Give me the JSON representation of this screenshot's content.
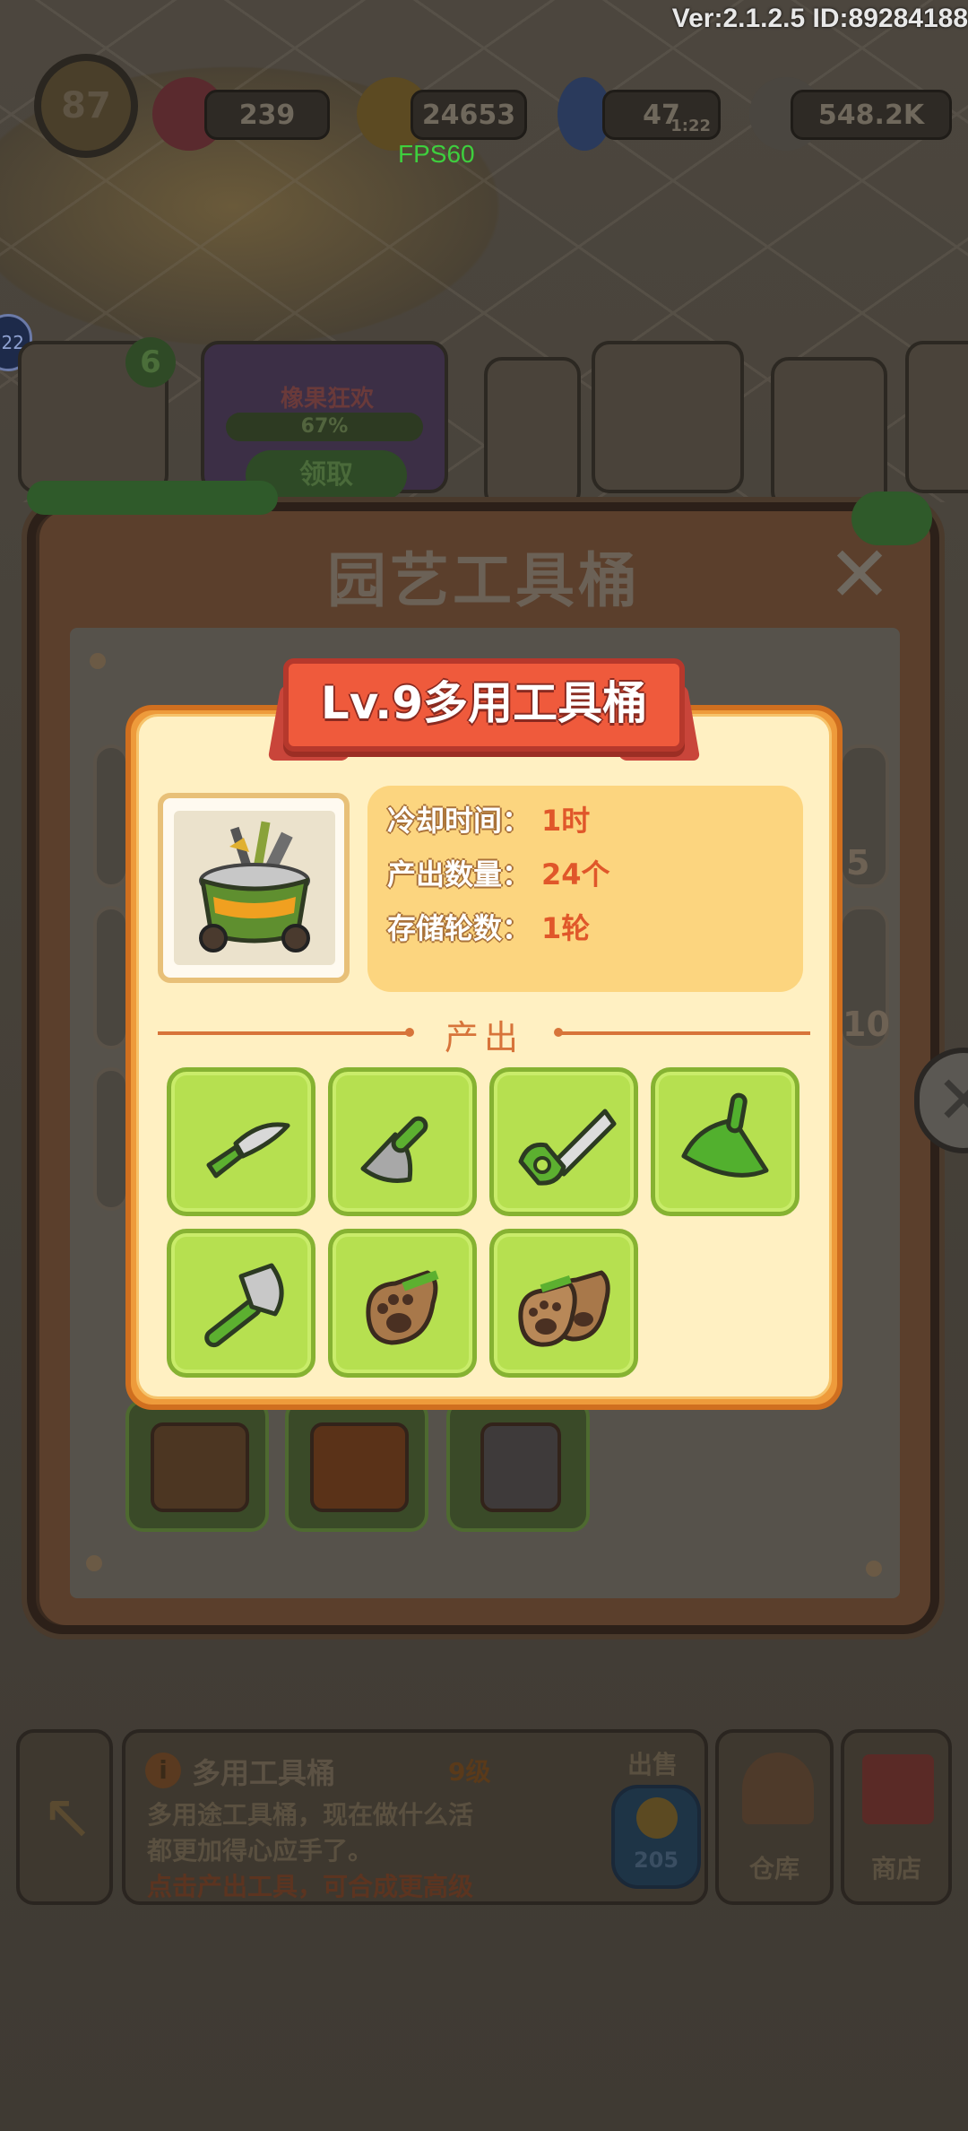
{
  "status": {
    "version_text": "Ver:2.1.2.5 ID:89284188",
    "fps_text": "FPS60"
  },
  "hud": {
    "level": "87",
    "gems": "239",
    "coins": "24653",
    "energy": "47",
    "energy_timer": "1:22",
    "seeds": "548.2K"
  },
  "background": {
    "badge_count": "6",
    "event_title": "橡果狂欢",
    "event_progress": "67%",
    "event_button": "领取",
    "left_edge_badge": "22",
    "side_counts": [
      "5",
      "10"
    ]
  },
  "dialog": {
    "title": "园艺工具桶",
    "close_icon": "close-x-icon"
  },
  "item_card": {
    "banner_title": "Lv.9多用工具桶",
    "stats": [
      {
        "label": "冷却时间：",
        "value": "1时"
      },
      {
        "label": "产出数量：",
        "value": "24个"
      },
      {
        "label": "存储轮数：",
        "value": "1轮"
      }
    ],
    "section_title": "产出",
    "outputs": [
      {
        "icon": "pruning-knife-icon"
      },
      {
        "icon": "garden-trowel-icon"
      },
      {
        "icon": "hand-saw-icon"
      },
      {
        "icon": "dustpan-icon"
      },
      {
        "icon": "hatchet-icon"
      },
      {
        "icon": "paw-glove-icon"
      },
      {
        "icon": "paw-gloves-pair-icon"
      }
    ]
  },
  "bottom_panel": {
    "item_name": "多用工具桶",
    "item_level": "9级",
    "description_line1": "多用途工具桶，现在做什么活",
    "description_line2": "都更加得心应手了。",
    "hint": "点击产出工具，可合成更高级",
    "sell_label": "出售",
    "sell_value": "205",
    "warehouse_label": "仓库",
    "shop_label": "商店"
  },
  "colors": {
    "banner_red": "#ef5a3c",
    "card_orange": "#ee9b3b",
    "card_cream": "#fff0c2",
    "slot_green": "#b6e050",
    "stat_value": "#e0572a"
  }
}
